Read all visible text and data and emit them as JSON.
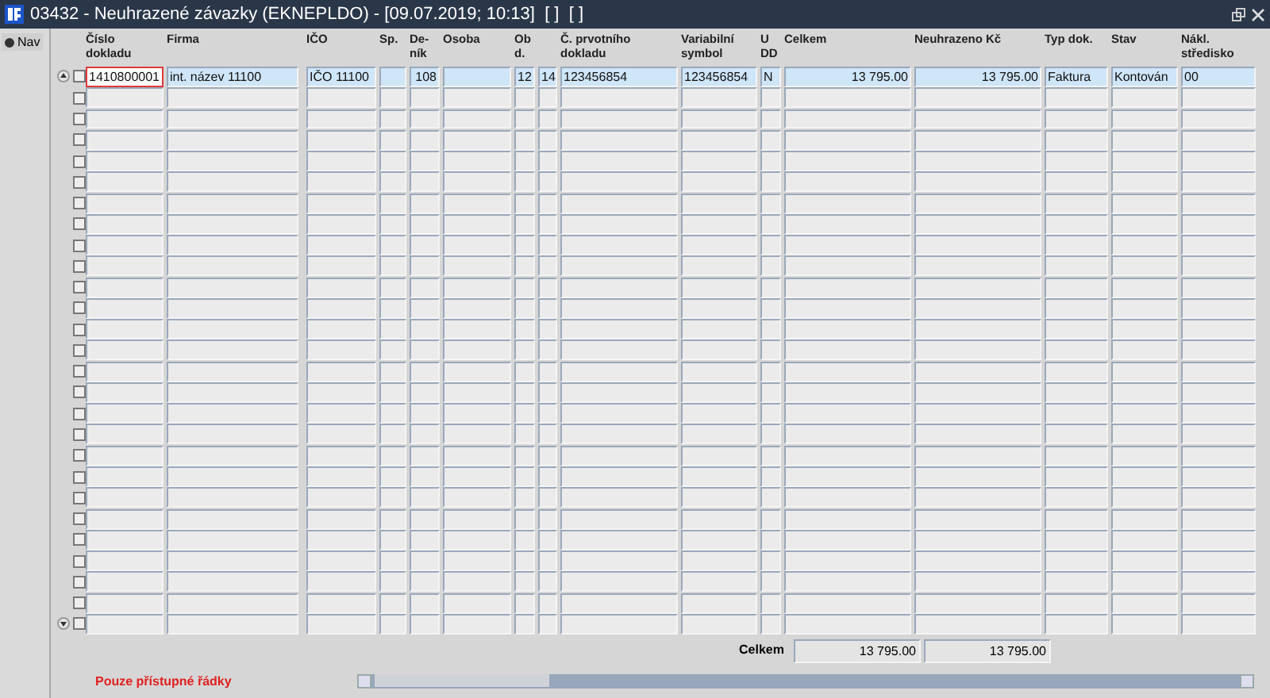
{
  "window": {
    "title": "03432 - Neuhrazené závazky (EKNEPLDO) - [09.07.2019; 10:13]  [ ]  [ ]"
  },
  "nav": {
    "label": "Nav",
    "selected": true
  },
  "table": {
    "columns": [
      {
        "label": "Číslo dokladu",
        "kind": "text"
      },
      {
        "label": "Firma",
        "kind": "text"
      },
      {
        "label": "IČO",
        "kind": "text"
      },
      {
        "label": "Sp.",
        "kind": "text"
      },
      {
        "label": "De-ník",
        "kind": "number"
      },
      {
        "label": "Osoba",
        "kind": "text"
      },
      {
        "label": "Ob d.",
        "kind": "text"
      },
      {
        "kind": "text"
      },
      {
        "label": "Č. prvotního dokladu",
        "kind": "text"
      },
      {
        "label": "Variabilní symbol",
        "kind": "text"
      },
      {
        "label": "U DD",
        "kind": "text"
      },
      {
        "label": "Celkem",
        "kind": "number"
      },
      {
        "label": "Neuhrazeno Kč",
        "kind": "number"
      },
      {
        "label": "Typ dok.",
        "kind": "text"
      },
      {
        "label": "Stav",
        "kind": "text"
      },
      {
        "label": "Nákl. středisko",
        "kind": "text"
      }
    ],
    "rows": [
      {
        "selected": true,
        "checked": false,
        "cells": [
          {
            "text": "1410800001",
            "focused": true
          },
          {
            "text": "int. název 11100",
            "focused": false
          },
          {
            "text": "IČO 11100",
            "focused": false
          },
          {
            "focused": false
          },
          {
            "text": "108",
            "focused": false
          },
          {
            "focused": false
          },
          {
            "text": "12",
            "focused": false
          },
          {
            "text": "14",
            "focused": false
          },
          {
            "text": "123456854",
            "focused": false
          },
          {
            "text": "123456854",
            "focused": false
          },
          {
            "text": "N",
            "focused": false
          },
          {
            "text": "13 795.00",
            "focused": false
          },
          {
            "text": "13 795.00",
            "focused": false
          },
          {
            "text": "Faktura",
            "focused": false
          },
          {
            "text": "Kontován",
            "focused": false
          },
          {
            "text": "00",
            "focused": false
          }
        ]
      },
      {
        "selected": false,
        "checked": false
      },
      {
        "selected": false,
        "checked": false
      },
      {
        "selected": false,
        "checked": false
      },
      {
        "selected": false,
        "checked": false
      },
      {
        "selected": false,
        "checked": false
      },
      {
        "selected": false,
        "checked": false
      },
      {
        "selected": false,
        "checked": false
      },
      {
        "selected": false,
        "checked": false
      },
      {
        "selected": false,
        "checked": false
      },
      {
        "selected": false,
        "checked": false
      },
      {
        "selected": false,
        "checked": false
      },
      {
        "selected": false,
        "checked": false
      },
      {
        "selected": false,
        "checked": false
      },
      {
        "selected": false,
        "checked": false
      },
      {
        "selected": false,
        "checked": false
      },
      {
        "selected": false,
        "checked": false
      },
      {
        "selected": false,
        "checked": false
      },
      {
        "selected": false,
        "checked": false
      },
      {
        "selected": false,
        "checked": false
      },
      {
        "selected": false,
        "checked": false
      },
      {
        "selected": false,
        "checked": false
      },
      {
        "selected": false,
        "checked": false
      },
      {
        "selected": false,
        "checked": false
      },
      {
        "selected": false,
        "checked": false
      },
      {
        "selected": false,
        "checked": false
      },
      {
        "selected": false,
        "checked": false
      }
    ],
    "totals": {
      "label": "Celkem",
      "values": [
        "13 795.00",
        "13 795.00"
      ]
    }
  },
  "footer": {
    "notice": "Pouze přístupné řádky"
  }
}
